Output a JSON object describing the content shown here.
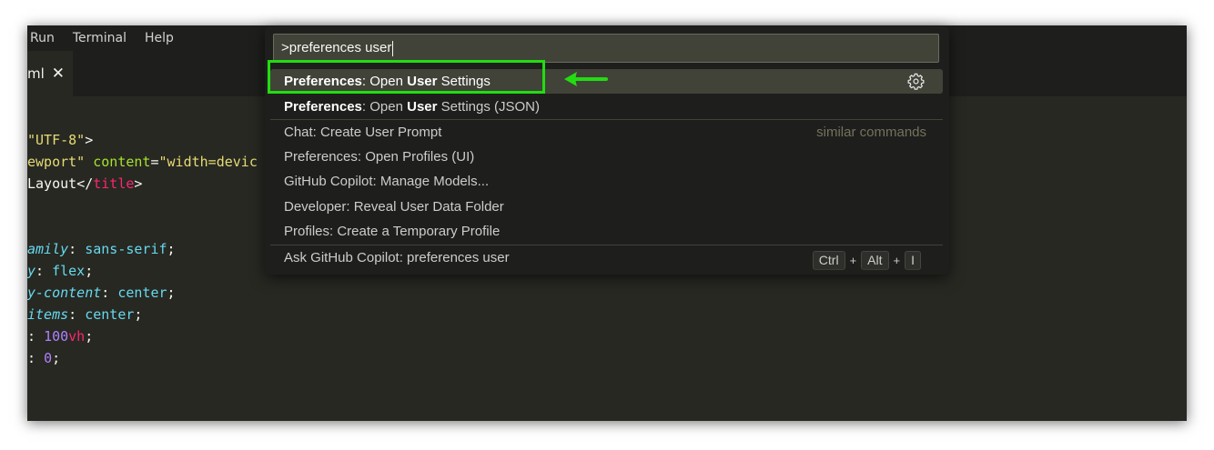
{
  "menubar": {
    "items": [
      "Run",
      "Terminal",
      "Help"
    ]
  },
  "tab": {
    "label": "ml",
    "close_glyph": "✕"
  },
  "editor": {
    "lines": [
      [
        {
          "t": "\"UTF-8\"",
          "c": "str"
        },
        {
          "t": ">",
          "c": "plain"
        }
      ],
      [
        {
          "t": "ewport\"",
          "c": "str"
        },
        {
          "t": " ",
          "c": "plain"
        },
        {
          "t": "content",
          "c": "attr"
        },
        {
          "t": "=",
          "c": "plain"
        },
        {
          "t": "\"width=devic",
          "c": "str"
        }
      ],
      [
        {
          "t": "Layout",
          "c": "plain"
        },
        {
          "t": "</",
          "c": "plain"
        },
        {
          "t": "title",
          "c": "tag"
        },
        {
          "t": ">",
          "c": "plain"
        }
      ],
      [],
      [
        {
          "t": "amily",
          "c": "prop"
        },
        {
          "t": ": ",
          "c": "plain"
        },
        {
          "t": "sans-serif",
          "c": "val"
        },
        {
          "t": ";",
          "c": "plain"
        }
      ],
      [
        {
          "t": "y",
          "c": "prop"
        },
        {
          "t": ": ",
          "c": "plain"
        },
        {
          "t": "flex",
          "c": "val"
        },
        {
          "t": ";",
          "c": "plain"
        }
      ],
      [
        {
          "t": "y-content",
          "c": "prop"
        },
        {
          "t": ": ",
          "c": "plain"
        },
        {
          "t": "center",
          "c": "val"
        },
        {
          "t": ";",
          "c": "plain"
        }
      ],
      [
        {
          "t": "items",
          "c": "prop"
        },
        {
          "t": ": ",
          "c": "plain"
        },
        {
          "t": "center",
          "c": "val"
        },
        {
          "t": ";",
          "c": "plain"
        }
      ],
      [
        {
          "t": ": ",
          "c": "plain"
        },
        {
          "t": "100",
          "c": "num"
        },
        {
          "t": "vh",
          "c": "unit"
        },
        {
          "t": ";",
          "c": "plain"
        }
      ],
      [
        {
          "t": ": ",
          "c": "plain"
        },
        {
          "t": "0",
          "c": "num"
        },
        {
          "t": ";",
          "c": "plain"
        }
      ]
    ]
  },
  "palette": {
    "input_value": ">preferences user",
    "items": [
      {
        "segments": [
          {
            "t": "Preferences",
            "b": true
          },
          {
            "t": ": Open ",
            "b": false
          },
          {
            "t": "User",
            "b": true
          },
          {
            "t": " Settings",
            "b": false
          }
        ],
        "selected": true,
        "icon": "gear-icon"
      },
      {
        "segments": [
          {
            "t": "Preferences",
            "b": true
          },
          {
            "t": ": Open ",
            "b": false
          },
          {
            "t": "User",
            "b": true
          },
          {
            "t": " Settings (JSON)",
            "b": false
          }
        ]
      },
      {
        "segments": [
          {
            "t": "Chat: Create User Prompt",
            "b": false
          }
        ],
        "right_label": "similar commands"
      },
      {
        "segments": [
          {
            "t": "Preferences: Open Profiles (UI)",
            "b": false
          }
        ]
      },
      {
        "segments": [
          {
            "t": "GitHub Copilot: Manage Models...",
            "b": false
          }
        ]
      },
      {
        "segments": [
          {
            "t": "Developer: Reveal User Data Folder",
            "b": false
          }
        ]
      },
      {
        "segments": [
          {
            "t": "Profiles: Create a Temporary Profile",
            "b": false
          }
        ]
      },
      {
        "segments": [
          {
            "t": "Ask GitHub Copilot: preferences user",
            "b": false
          }
        ],
        "shortcut": [
          "Ctrl",
          "Alt",
          "I"
        ]
      }
    ]
  },
  "annotation": {
    "box_color": "#22dd11",
    "arrow_color": "#22dd11",
    "arrow_icon": "left-arrow-icon"
  },
  "colors": {
    "editor_bg": "#272822",
    "chrome_bg": "#1e1f1c",
    "selection_bg": "#414339"
  }
}
